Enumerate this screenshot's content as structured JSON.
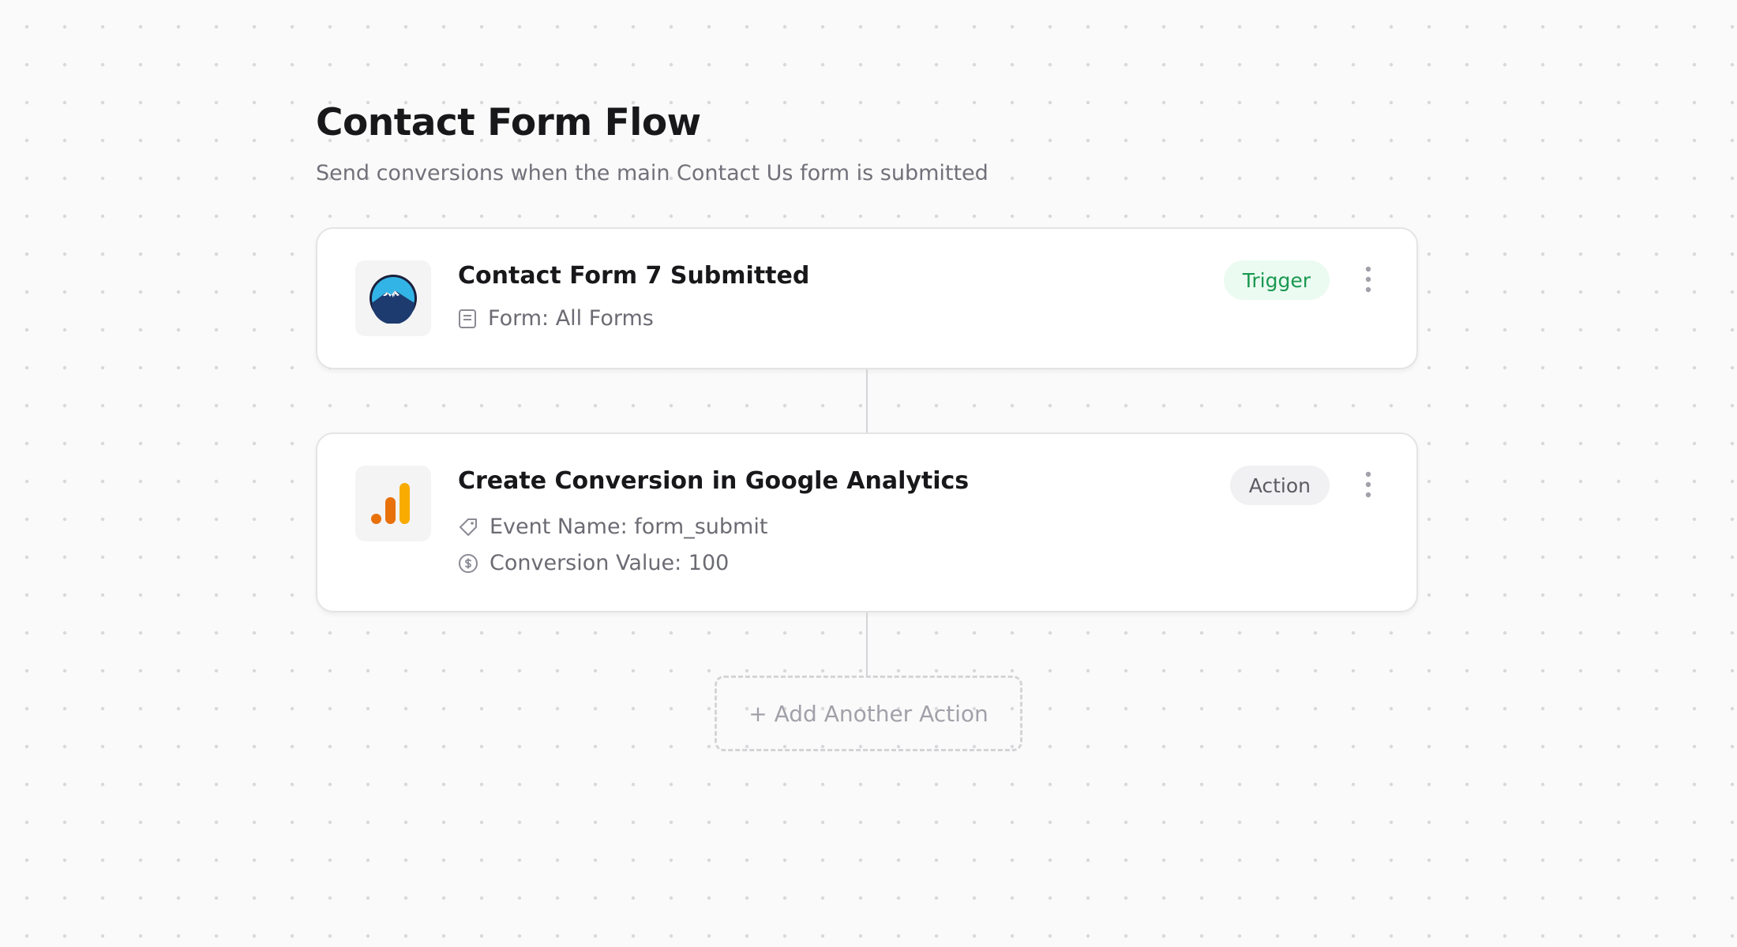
{
  "header": {
    "title": "Contact Form Flow",
    "subtitle": "Send conversions when the main Contact Us form is submitted"
  },
  "trigger_card": {
    "app_icon": "contact-form-7-mountain-logo",
    "title": "Contact Form 7 Submitted",
    "form_icon": "form-document-icon",
    "form_label": "Form: All Forms",
    "badge": "Trigger",
    "badge_color": "#1a9850",
    "badge_bg": "#ebfbf1"
  },
  "action_card": {
    "app_icon": "google-analytics-logo",
    "title": "Create Conversion in Google Analytics",
    "event_icon": "tag-icon",
    "event_label": "Event Name: form_submit",
    "value_icon": "dollar-circle-icon",
    "value_label": "Conversion Value: 100",
    "badge": "Action",
    "badge_color": "#5b5b63",
    "badge_bg": "#f1f1f3"
  },
  "add_action_label": "+ Add Another Action",
  "colors": {
    "background": "#fafafa",
    "dot_grid": "#d9d9dc",
    "card_border": "#e4e4e7",
    "text_primary": "#18181b",
    "text_secondary": "#71717a",
    "ga_orange": "#e8710a",
    "ga_yellow": "#f9ab00"
  }
}
